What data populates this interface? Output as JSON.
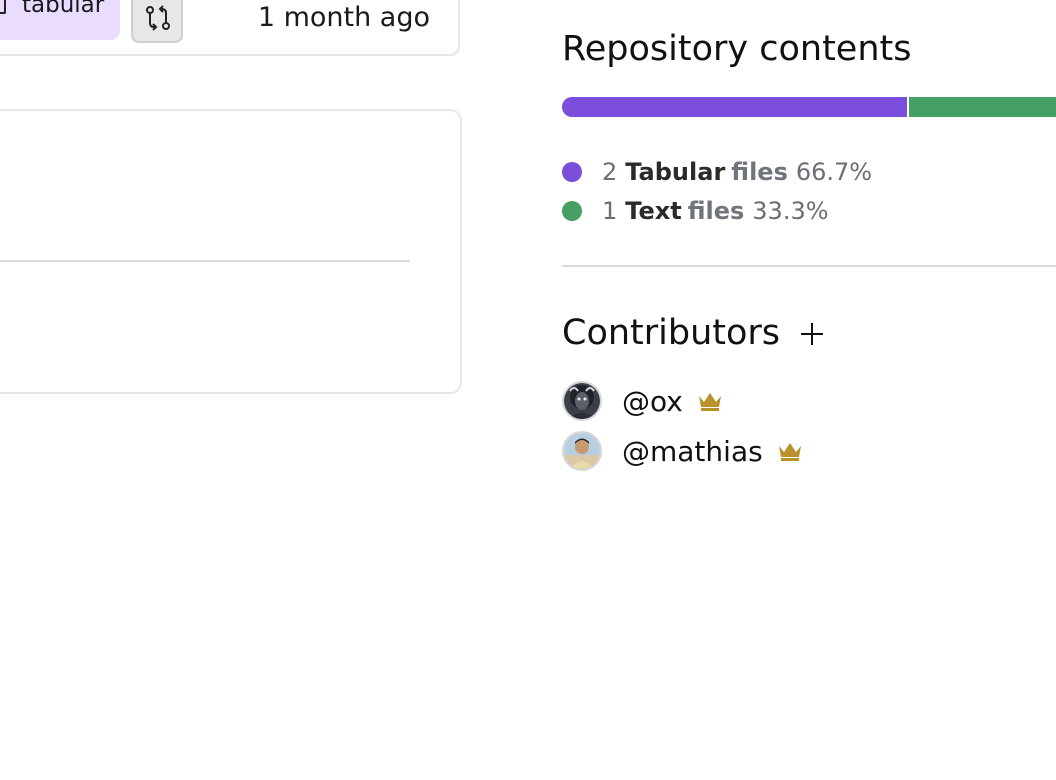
{
  "file_row": {
    "tag_label": "tabular",
    "updated": "1 month ago"
  },
  "repository_contents": {
    "title": "Repository contents",
    "breakdown": [
      {
        "count": "2",
        "type": "Tabular",
        "files_word": "files",
        "percent": "66.7%",
        "fraction": 0.667,
        "color": "#7b4fdc"
      },
      {
        "count": "1",
        "type": "Text",
        "files_word": "files",
        "percent": "33.3%",
        "fraction": 0.333,
        "color": "#46a063"
      }
    ]
  },
  "contributors": {
    "title": "Contributors",
    "people": [
      {
        "handle": "@ox",
        "role_icon": "crown-icon"
      },
      {
        "handle": "@mathias",
        "role_icon": "crown-icon"
      }
    ]
  },
  "colors": {
    "crown": "#b8912a",
    "tag_bg": "#eadcff"
  }
}
